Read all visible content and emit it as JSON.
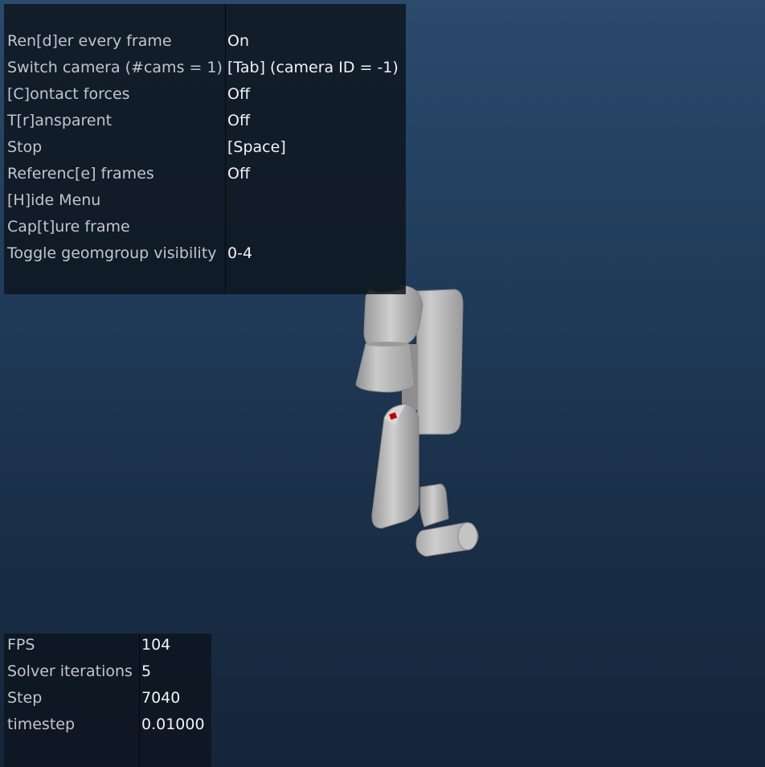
{
  "help_menu": {
    "rows": [
      {
        "key": "Ren[d]er every frame",
        "value": "On"
      },
      {
        "key": "Switch camera (#cams = 1)",
        "value": "[Tab] (camera ID = -1)"
      },
      {
        "key": "[C]ontact forces",
        "value": "Off"
      },
      {
        "key": "T[r]ansparent",
        "value": "Off"
      },
      {
        "key": "Stop",
        "value": "[Space]"
      },
      {
        "key": "Referenc[e] frames",
        "value": "Off"
      },
      {
        "key": "[H]ide Menu",
        "value": ""
      },
      {
        "key": "Cap[t]ure frame",
        "value": ""
      },
      {
        "key": "Toggle geomgroup visibility",
        "value": "0-4"
      }
    ]
  },
  "info_panel": {
    "rows": [
      {
        "key": "FPS",
        "value": "104"
      },
      {
        "key": "Solver iterations",
        "value": "5"
      },
      {
        "key": "Step",
        "value": "7040"
      },
      {
        "key": "timestep",
        "value": "0.01000"
      }
    ]
  },
  "colors": {
    "background_top": "#2b4a6c",
    "background_bottom": "#14253a",
    "panel": "#0e1620",
    "robot_body": "#c8c8c8",
    "marker": "#c00000"
  },
  "icons": {
    "robot_arm": "robot-arm-model",
    "marker": "red-target-marker"
  }
}
